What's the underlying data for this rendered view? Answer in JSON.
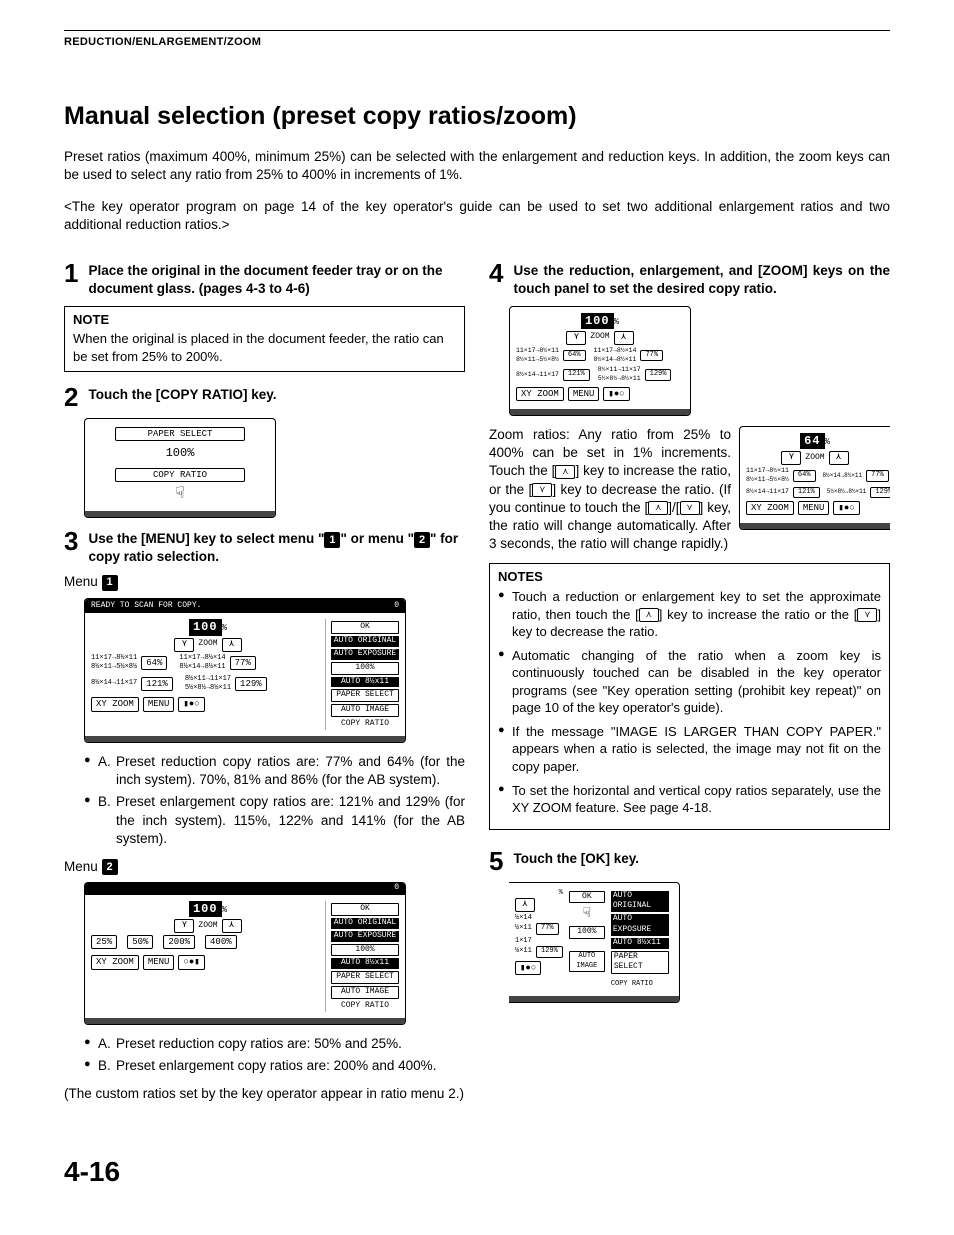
{
  "header": "REDUCTION/ENLARGEMENT/ZOOM",
  "title": "Manual selection (preset copy ratios/zoom)",
  "intro": "Preset ratios (maximum 400%, minimum 25%) can be selected with the enlargement and reduction keys. In addition, the zoom keys can be used to select any ratio from 25% to 400% in increments of 1%.",
  "subintro": "<The key operator program on page 14 of the key operator's guide can be used to set two additional enlargement ratios and two additional reduction ratios.>",
  "step1": {
    "num": "1",
    "text": "Place the original in the document feeder tray or on the document glass. (pages 4-3 to 4-6)"
  },
  "note1": {
    "title": "NOTE",
    "text": "When the original is placed in the document feeder, the ratio can be set from 25% to 200%."
  },
  "step2": {
    "num": "2",
    "text": "Touch the [COPY RATIO] key."
  },
  "fig2": {
    "paper_select": "PAPER SELECT",
    "percent": "100%",
    "copy_ratio": "COPY RATIO"
  },
  "step3": {
    "num": "3",
    "pre": "Use the [MENU] key to select menu \"",
    "mid": "\" or menu \"",
    "post": "\" for copy ratio selection.",
    "badge1": "1",
    "badge2": "2"
  },
  "menu1": {
    "label": "Menu",
    "badge": "1",
    "ready": "READY TO SCAN FOR COPY.",
    "disp": "100",
    "pct": "%",
    "zoom": "ZOOM",
    "left1a": "11×17→8½×11",
    "left1b": "8½×11→5½×8½",
    "left1v": "64%",
    "right1a": "11×17→8½×14",
    "right1b": "8½×14→8½×11",
    "right1v": "77%",
    "left2": "8½×14→11×17",
    "left2v": "121%",
    "right2a": "8½×11→11×17",
    "right2b": "5½×8½→8½×11",
    "right2v": "129%",
    "xy": "XY ZOOM",
    "menu": "MENU",
    "ok": "OK",
    "b100": "100%",
    "auto_original": "AUTO ORIGINAL",
    "auto_exposure": "AUTO EXPOSURE",
    "paper": "AUTO  8½x11",
    "paper_select": "PAPER SELECT",
    "auto_image": "AUTO IMAGE",
    "copy_ratio": "COPY RATIO",
    "a_text": "Preset reduction copy ratios are: 77% and 64% (for the inch system). 70%, 81% and 86% (for the AB system).",
    "b_text": "Preset enlargement copy ratios are: 121% and 129% (for the inch system). 115%, 122% and 141% (for the AB system)."
  },
  "menu2": {
    "label": "Menu",
    "badge": "2",
    "disp": "100",
    "pct": "%",
    "zoom": "ZOOM",
    "b25": "25%",
    "b50": "50%",
    "b200": "200%",
    "b400": "400%",
    "xy": "XY ZOOM",
    "menu": "MENU",
    "ok": "OK",
    "b100": "100%",
    "auto_original": "AUTO ORIGINAL",
    "auto_exposure": "AUTO EXPOSURE",
    "paper": "AUTO  8½x11",
    "paper_select": "PAPER SELECT",
    "auto_image": "AUTO IMAGE",
    "copy_ratio": "COPY RATIO",
    "a_text": "Preset reduction copy ratios are: 50% and 25%.",
    "b_text": "Preset enlargement copy ratios are: 200% and 400%."
  },
  "custom_note": "(The custom ratios set by the key operator appear in ratio menu 2.)",
  "step4": {
    "num": "4",
    "text": "Use the reduction, enlargement, and [ZOOM] keys on the touch panel to set the desired copy ratio."
  },
  "fig4a": {
    "disp": "100",
    "pct": "%",
    "zoom": "ZOOM",
    "left1a": "11×17→8½×11",
    "left1b": "8½×11→5½×8½",
    "left1v": "64%",
    "right1a": "11×17→8½×14",
    "right1b": "8½×14→8½×11",
    "right1v": "77%",
    "left2": "8½×14→11×17",
    "left2v": "121%",
    "right2a": "8½×11→11×17",
    "right2b": "5½×8½→8½×11",
    "right2v": "129%",
    "xy": "XY ZOOM",
    "menu": "MENU"
  },
  "fig4b": {
    "disp": "64"
  },
  "zoom_para": {
    "p1": "Zoom ratios: Any ratio from 25% to 400% can be set in 1% increments. Touch the [",
    "p2": "] key to increase the ratio, or the [",
    "p3": "] key to decrease the ratio. (If you continue to touch the [",
    "p4": "]/[",
    "p5": "] key, the ratio will change automatically. After 3 seconds, the ratio will change rapidly.)"
  },
  "notes_block": {
    "title": "NOTES",
    "n1a": "Touch a reduction or enlargement key to set the approximate ratio, then touch the [",
    "n1b": "] key to increase the ratio or the [",
    "n1c": "] key to decrease the ratio.",
    "n2": "Automatic changing of the ratio when a zoom key is continuously touched can be disabled in the key operator programs (see \"Key operation setting (prohibit key repeat)\" on page 10 of the key operator's guide).",
    "n3": "If the message \"IMAGE IS LARGER THAN COPY PAPER.\" appears when a ratio is selected, the image may not fit on the copy paper.",
    "n4": "To set the horizontal and vertical copy ratios separately, use the XY ZOOM feature. See page 4-18."
  },
  "step5": {
    "num": "5",
    "text": "Touch the [OK] key."
  },
  "fig5": {
    "pct": "%",
    "ok": "OK",
    "b100": "100%",
    "left1": "½×14",
    "left1b": "½×11",
    "left1v": "77%",
    "left2": "1×17",
    "left2b": "½×11",
    "left2v": "129%",
    "auto_original": "AUTO ORIGINAL",
    "auto_exposure": "AUTO EXPOSURE",
    "paper": "AUTO  8½x11",
    "paper_select": "PAPER SELECT",
    "auto_image": "AUTO IMAGE",
    "copy_ratio": "COPY RATIO"
  },
  "page_num": "4-16"
}
